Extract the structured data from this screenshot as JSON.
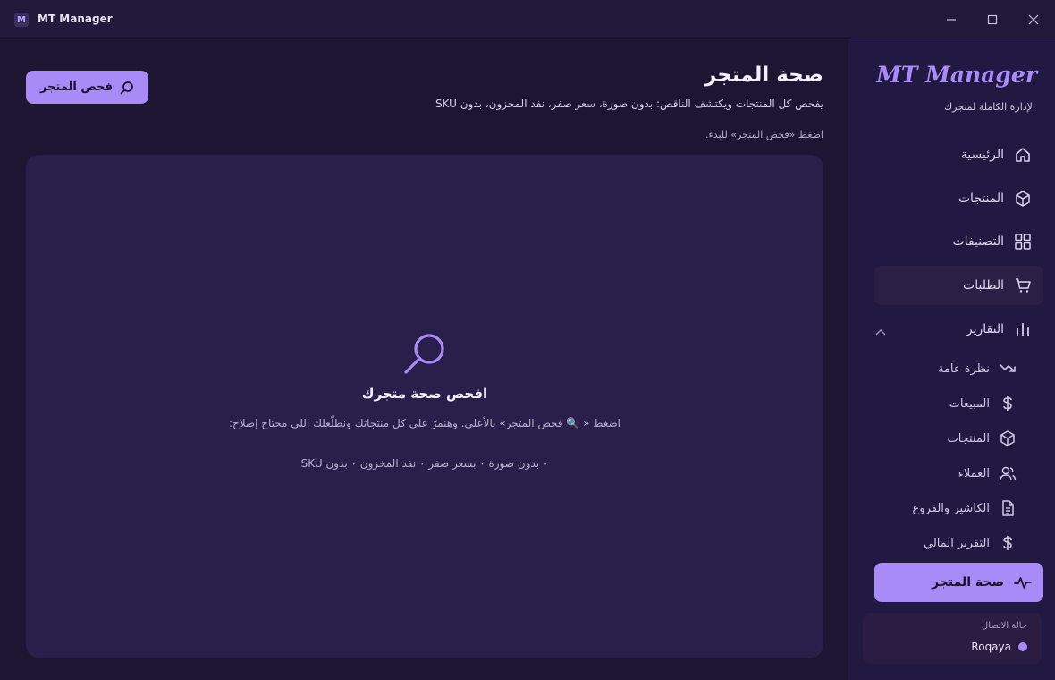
{
  "titlebar": {
    "app_icon_letter": "M",
    "title": "MT Manager"
  },
  "main": {
    "scan_button_label": "فحص المتجر",
    "title": "صحة المتجر",
    "subtitle": "يفحص كل المنتجات ويكتشف الناقص: بدون صورة، سعر صفر، نفد المخزون، بدون SKU",
    "hint": "اضغط «فحص المتجر» للبدء.",
    "empty_state": {
      "title": "افحص صحة متجرك",
      "description": "اضغط « 🔍 فحص المتجر» بالأعلى. وهنمرّ على كل منتجاتك ونطلّعلك اللي محتاج إصلاح:",
      "tags": "٠ بدون صورة   ٠ بسعر صفر   ٠ نفد المخزون   ٠ بدون SKU"
    }
  },
  "sidebar": {
    "brand": "MT Manager",
    "brand_sub": "الإدارة الكاملة لمتجرك",
    "items": [
      {
        "label": "الرئيسية",
        "icon": "home-icon"
      },
      {
        "label": "المنتجات",
        "icon": "box-icon"
      },
      {
        "label": "التصنيفات",
        "icon": "grid-icon"
      },
      {
        "label": "الطلبات",
        "icon": "cart-icon"
      },
      {
        "label": "التقارير",
        "icon": "chart-icon"
      }
    ],
    "report_sub_items": [
      {
        "label": "نظرة عامة",
        "icon": "trend-icon"
      },
      {
        "label": "المبيعات",
        "icon": "dollar-icon"
      },
      {
        "label": "المنتجات",
        "icon": "box-icon"
      },
      {
        "label": "العملاء",
        "icon": "users-icon"
      },
      {
        "label": "الكاشير والفروع",
        "icon": "document-icon"
      },
      {
        "label": "التقرير المالي",
        "icon": "dollar-icon"
      }
    ],
    "active_item": {
      "label": "صحة المتجر",
      "icon": "pulse-icon"
    },
    "status": {
      "label": "حالة الاتصال",
      "user": "Roqaya"
    }
  }
}
